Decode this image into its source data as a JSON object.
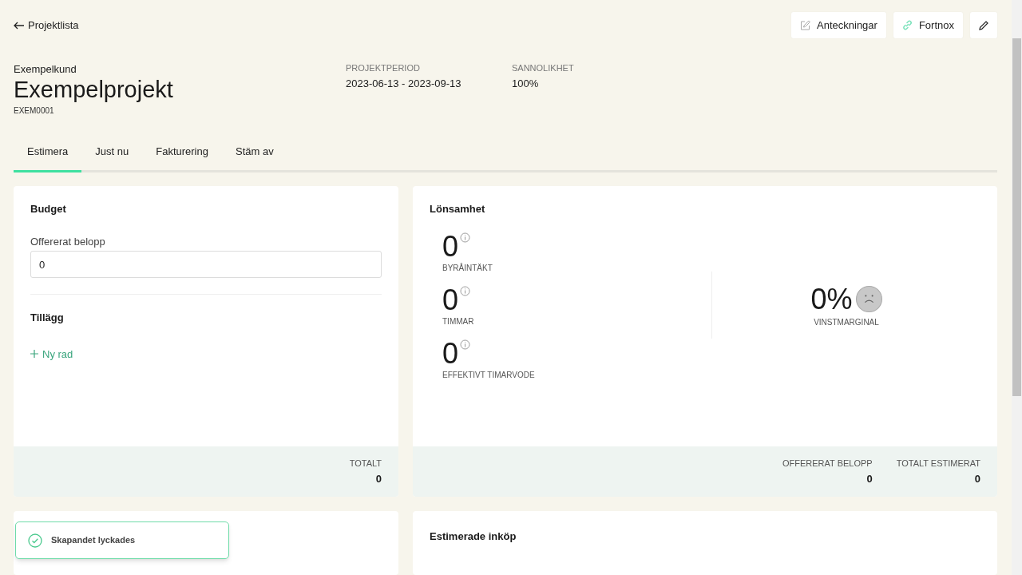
{
  "back_link": {
    "label": "Projektlista"
  },
  "toolbar": [
    {
      "kind": "notes",
      "label": "Anteckningar"
    },
    {
      "kind": "link",
      "label": "Fortnox"
    },
    {
      "kind": "edit"
    }
  ],
  "project": {
    "customer": "Exempelkund",
    "name": "Exempelprojekt",
    "code": "EXEM0001"
  },
  "meta": [
    {
      "label": "PROJEKTPERIOD",
      "value": "2023-06-13 - 2023-09-13"
    },
    {
      "label": "SANNOLIKHET",
      "value": "100%"
    }
  ],
  "tabs": [
    {
      "label": "Estimera",
      "selected": true
    },
    {
      "label": "Just nu",
      "selected": false
    },
    {
      "label": "Fakturering",
      "selected": false
    },
    {
      "label": "Stäm av",
      "selected": false
    }
  ],
  "budget": {
    "title": "Budget",
    "field_label": "Offererat belopp",
    "field_value": "0",
    "section": "Tillägg",
    "add_row": "Ny rad",
    "totals": [
      {
        "label": "TOTALT",
        "value": "0"
      }
    ]
  },
  "profitability": {
    "title": "Lönsamhet",
    "metrics": [
      {
        "value": "0",
        "label": "BYRÅINTÄKT"
      },
      {
        "value": "0",
        "label": "TIMMAR"
      },
      {
        "value": "0",
        "label": "EFFEKTIVT TIMARVODE"
      }
    ],
    "margin": {
      "value": "0%",
      "label": "VINSTMARGINAL",
      "kind": "sad"
    },
    "totals": [
      {
        "label": "OFFERERAT BELOPP",
        "value": "0"
      },
      {
        "label": "TOTALT ESTIMERAT",
        "value": "0"
      }
    ]
  },
  "lower_cards": [
    {
      "kind": "blank"
    },
    {
      "kind": "titled",
      "title": "Estimerade inköp"
    }
  ],
  "toast": {
    "message": "Skapandet lyckades"
  }
}
